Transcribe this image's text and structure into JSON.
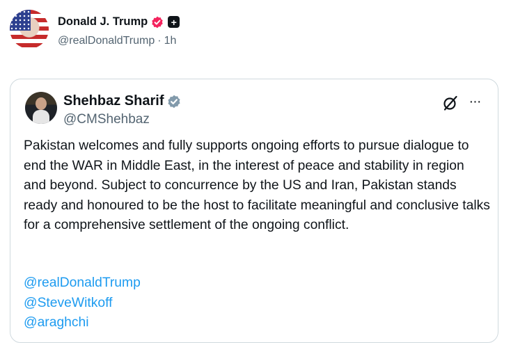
{
  "post": {
    "author_name": "Donald J. Trump",
    "handle": "@realDonaldTrump",
    "separator": "·",
    "time": "1h",
    "plus_badge": "+"
  },
  "quoted": {
    "author_name": "Shehbaz Sharif",
    "handle": "@CMShehbaz",
    "more_label": "···",
    "body": "Pakistan welcomes and fully supports ongoing efforts to pursue dialogue to end the WAR in Middle East, in the interest of peace and stability in region and beyond. Subject to concurrence by the US and Iran, Pakistan stands ready and honoured to be the host to facilitate meaningful and conclusive talks for a comprehensive settlement of the ongoing conflict.",
    "mentions": [
      "@realDonaldTrump",
      "@SteveWitkoff",
      "@araghchi"
    ]
  },
  "colors": {
    "text": "#0f1419",
    "secondary": "#536471",
    "link": "#1d9bf0",
    "border": "#cfd9de",
    "verified_pink": "#f4245e",
    "verified_gray": "#829aab"
  },
  "icons": [
    "verified-badge-icon",
    "plus-badge-icon",
    "grok-icon",
    "more-icon"
  ]
}
